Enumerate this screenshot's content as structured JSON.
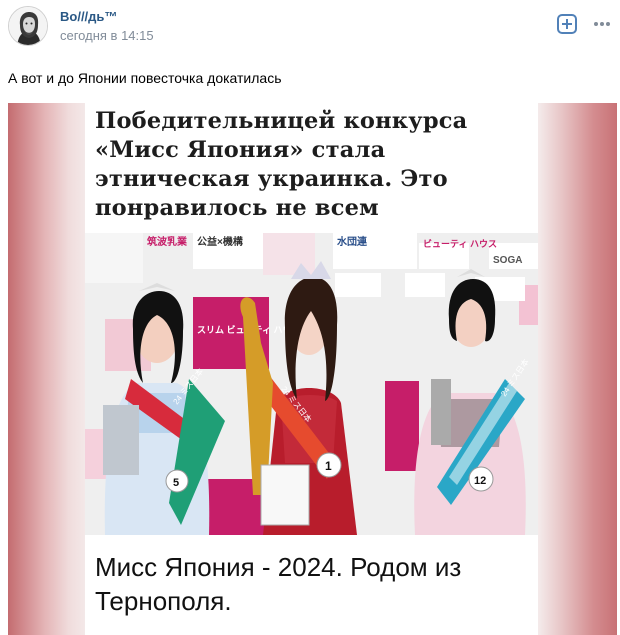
{
  "post": {
    "author": "Во///дь™",
    "time": "сегодня в 14:15",
    "text": "А вот и до Японии повесточка докатилась"
  },
  "card": {
    "headline_lines": [
      "Победительницей конкурса",
      "«Мисс Япония» стала",
      "этническая украинка. Это",
      "понравилось не всем"
    ],
    "caption_lines": [
      "Мисс Япония - 2024. Родом из",
      "Тернополя."
    ]
  },
  "photo": {
    "contestants": [
      {
        "number": "5",
        "sash": "24 ミス日本"
      },
      {
        "number": "1",
        "sash": "24 ミス日本"
      },
      {
        "number": "12",
        "sash": "24 ミス日本"
      }
    ],
    "backdrop": {
      "sponsors": [
        "筑波乳業",
        "公益×機構",
        "水団連",
        "ビューティ ハウス",
        "SOGA",
        "スリム ビューティ ハウス"
      ]
    }
  },
  "icons": {
    "add": "plus-square-icon",
    "more": "more-dots-icon"
  },
  "colors": {
    "author_link": "#2a5885",
    "meta": "#818c99",
    "accent": "#5181b8"
  }
}
